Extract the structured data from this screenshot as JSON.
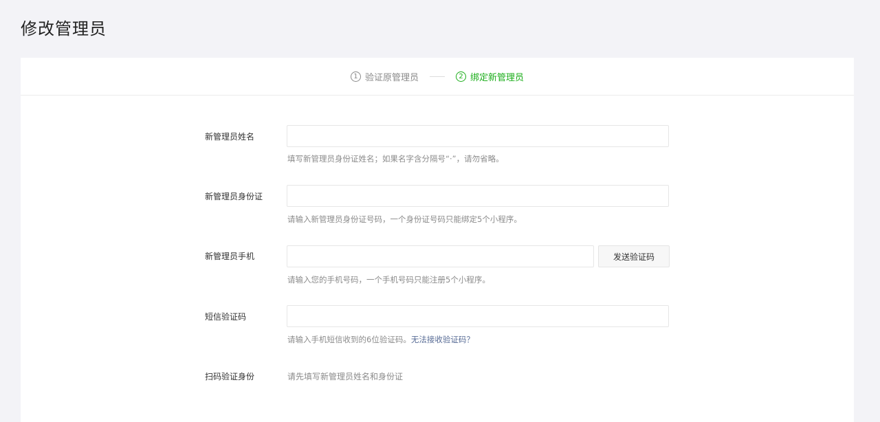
{
  "page": {
    "title": "修改管理员"
  },
  "steps": [
    {
      "num": "1",
      "label": "验证原管理员",
      "active": false
    },
    {
      "num": "2",
      "label": "绑定新管理员",
      "active": true
    }
  ],
  "form": {
    "name": {
      "label": "新管理员姓名",
      "value": "",
      "placeholder": "",
      "hint": "填写新管理员身份证姓名；如果名字含分隔号“·”，请勿省略。"
    },
    "id_card": {
      "label": "新管理员身份证",
      "value": "",
      "placeholder": "",
      "hint": "请输入新管理员身份证号码，一个身份证号码只能绑定5个小程序。"
    },
    "phone": {
      "label": "新管理员手机",
      "value": "",
      "placeholder": "",
      "send_button": "发送验证码",
      "hint": "请输入您的手机号码，一个手机号码只能注册5个小程序。"
    },
    "sms_code": {
      "label": "短信验证码",
      "value": "",
      "placeholder": "",
      "hint": "请输入手机短信收到的6位验证码。",
      "hint_link": "无法接收验证码？"
    },
    "scan": {
      "label": "扫码验证身份",
      "text": "请先填写新管理员姓名和身份证"
    }
  },
  "colors": {
    "accent": "#1aad19",
    "link": "#576b95",
    "background": "#f3f3f7"
  }
}
